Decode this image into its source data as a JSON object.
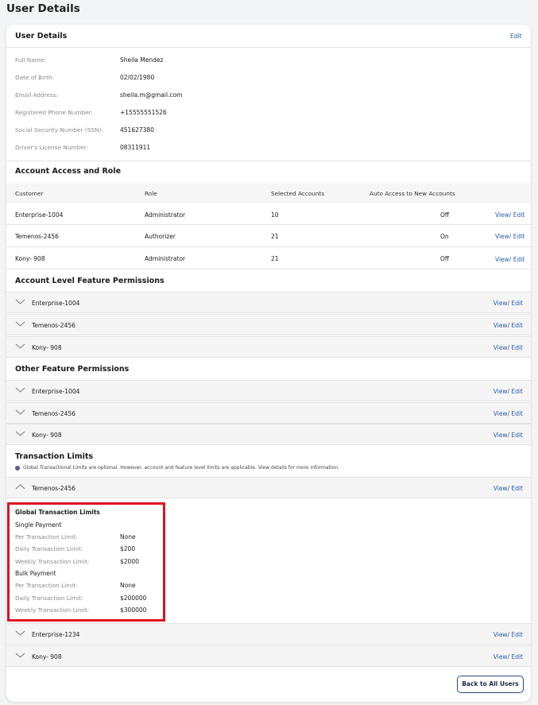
{
  "page_title": "User Details",
  "user_details": {
    "title": "User Details",
    "edit_label": "Edit",
    "fields": [
      {
        "label": "Full Name:",
        "value": "Sheila Mendez"
      },
      {
        "label": "Date of Birth:",
        "value": "02/02/1980"
      },
      {
        "label": "Email Address:",
        "value": "sheila.m@gmail.com"
      },
      {
        "label": "Registered Phone Number:",
        "value": "+15555551526"
      },
      {
        "label": "Social Security Number (SSN):",
        "value": "451627380"
      },
      {
        "label": "Driver's License Number:",
        "value": "08311911"
      }
    ]
  },
  "account_access": {
    "title": "Account Access and Role",
    "columns": [
      "Customer",
      "Role",
      "Selected Accounts",
      "Auto Access to New Accounts"
    ],
    "rows": [
      {
        "customer": "Enterprise-1004",
        "role": "Administrator",
        "accounts": "10",
        "auto": "Off",
        "action": "View/ Edit"
      },
      {
        "customer": "Temenos-2456",
        "role": "Authorizer",
        "accounts": "21",
        "auto": "On",
        "action": "View/ Edit"
      },
      {
        "customer": "Kony- 908",
        "role": "Administrator",
        "accounts": "21",
        "auto": "Off",
        "action": "View/ Edit"
      }
    ]
  },
  "account_feature_permissions": {
    "title": "Account Level Feature Permissions",
    "items": [
      {
        "name": "Enterprise-1004",
        "action": "View/ Edit"
      },
      {
        "name": "Temenos-2456",
        "action": "View/ Edit"
      },
      {
        "name": "Kony- 908",
        "action": "View/ Edit"
      }
    ]
  },
  "other_feature_permissions": {
    "title": "Other Feature Permissions",
    "items": [
      {
        "name": "Enterprise-1004",
        "action": "View/ Edit"
      },
      {
        "name": "Temenos-2456",
        "action": "View/ Edit"
      },
      {
        "name": "Kony- 908",
        "action": "View/ Edit"
      }
    ]
  },
  "transaction_limits": {
    "title": "Transaction Limits",
    "note": "Global Transactional Limits are optional. However, account and feature level limits are applicable. View details for more information.",
    "expanded": {
      "name": "Temenos-2456",
      "action": "View/ Edit"
    },
    "global": {
      "title": "Global Transaction Limits",
      "single_payment": "Single Payment",
      "bulk_payment": "Bulk Payment",
      "single": [
        {
          "label": "Per Transaction Limit:",
          "value": "None"
        },
        {
          "label": "Daily Transaction Limit:",
          "value": "$200"
        },
        {
          "label": "Weekly Transaction Limit:",
          "value": "$2000"
        }
      ],
      "bulk": [
        {
          "label": "Per Transaction Limit:",
          "value": "None"
        },
        {
          "label": "Daily Transaction Limit:",
          "value": "$200000"
        },
        {
          "label": "Weekly Transaction Limit:",
          "value": "$300000"
        }
      ]
    },
    "collapsed": [
      {
        "name": "Enterprise-1234",
        "action": "View/ Edit"
      },
      {
        "name": "Kony- 908",
        "action": "View/ Edit"
      }
    ]
  },
  "back_button": "Back to All Users",
  "colors": {
    "link": "#2b5cab",
    "highlight": "#e0101f",
    "button_border": "#2e4a78"
  }
}
